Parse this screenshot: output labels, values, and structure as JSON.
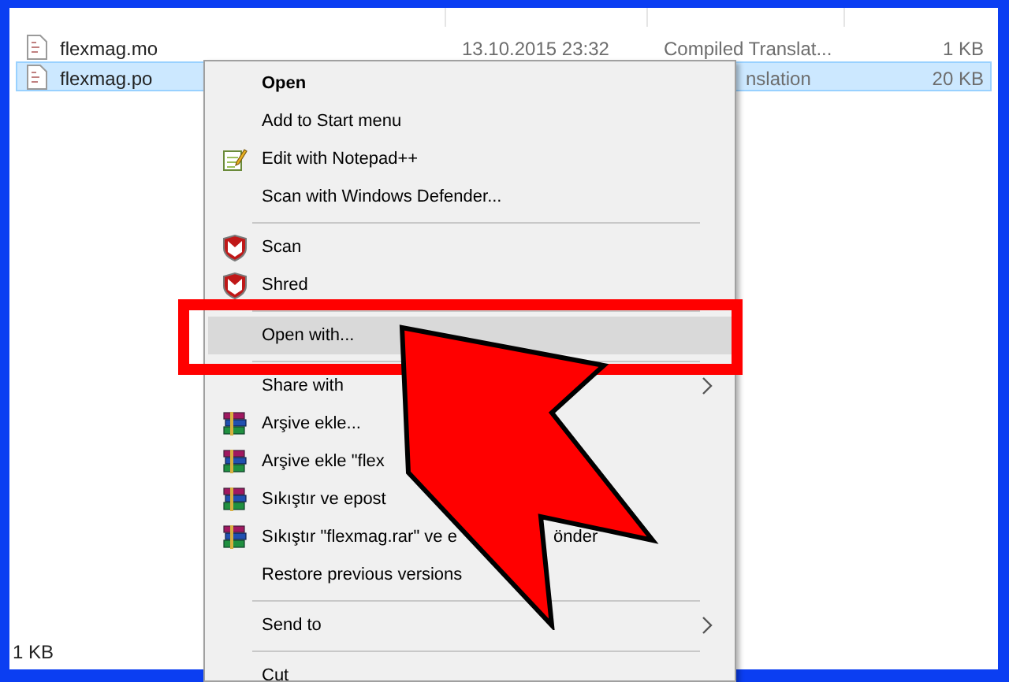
{
  "files": [
    {
      "name": "flexmag.mo",
      "date": "13.10.2015 23:32",
      "type": "Compiled Translat...",
      "size": "1 KB",
      "selected": false
    },
    {
      "name": "flexmag.po",
      "type": "nslation",
      "size": "20 KB",
      "selected": true
    }
  ],
  "context_menu": {
    "items": [
      {
        "kind": "item",
        "label": "Open",
        "default": true,
        "highlighted": false
      },
      {
        "kind": "item",
        "label": "Add to Start menu",
        "highlighted": false
      },
      {
        "kind": "item",
        "label": "Edit with Notepad++",
        "highlighted": false
      },
      {
        "kind": "item",
        "label": "Scan with Windows Defender...",
        "highlighted": false
      },
      {
        "kind": "separator"
      },
      {
        "kind": "item",
        "label": "Scan",
        "highlighted": false
      },
      {
        "kind": "item",
        "label": "Shred",
        "highlighted": false
      },
      {
        "kind": "separator"
      },
      {
        "kind": "item",
        "label": "Open with...",
        "highlighted": true
      },
      {
        "kind": "separator"
      },
      {
        "kind": "item",
        "label": "Share with",
        "submenu": true,
        "highlighted": false
      },
      {
        "kind": "item",
        "label": "Arşive ekle...",
        "highlighted": false
      },
      {
        "kind": "item",
        "label": "Arşive ekle \"flex",
        "highlighted": false
      },
      {
        "kind": "item",
        "label": "Sıkıştır ve epost",
        "highlighted": false
      },
      {
        "kind": "item",
        "label": "Sıkıştır \"flexmag.rar\" ve e",
        "label_tail": "önder",
        "highlighted": false
      },
      {
        "kind": "item",
        "label": "Restore previous versions",
        "highlighted": false
      },
      {
        "kind": "separator"
      },
      {
        "kind": "item",
        "label": "Send to",
        "submenu": true,
        "highlighted": false
      },
      {
        "kind": "separator"
      },
      {
        "kind": "item",
        "label": "Cut",
        "highlighted": false
      }
    ]
  },
  "status_bar": {
    "text": "1 KB"
  }
}
